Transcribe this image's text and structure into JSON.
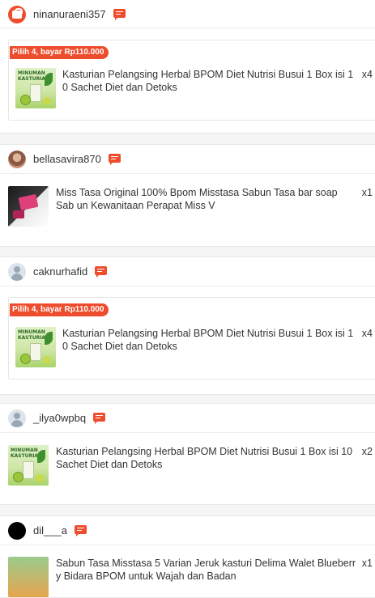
{
  "orders": [
    {
      "username": "ninanuraeni357",
      "promo": "Pilih 4, bayar Rp110.000",
      "item_title": "Kasturian Pelangsing Herbal BPOM Diet Nutrisi Busui 1 Box isi 1 0 Sachet Diet dan Detoks",
      "thumb_text": "MINUMAN KASTURIAN",
      "qty": "x4"
    },
    {
      "username": "bellasavira870",
      "item_title": "Miss Tasa Original 100% Bpom Misstasa Sabun Tasa bar soap Sab un Kewanitaan Perapat Miss V",
      "qty": "x1"
    },
    {
      "username": "caknurhafid",
      "promo": "Pilih 4, bayar Rp110.000",
      "item_title": "Kasturian Pelangsing Herbal BPOM Diet Nutrisi Busui 1 Box isi 1 0 Sachet Diet dan Detoks",
      "thumb_text": "MINUMAN KASTURIAN",
      "qty": "x4"
    },
    {
      "username": "_ilya0wpbq",
      "item_title": "Kasturian Pelangsing Herbal BPOM Diet Nutrisi Busui 1 Box isi 10 Sachet Diet dan Detoks",
      "thumb_text": "MINUMAN KASTURIAN",
      "qty": "x2"
    },
    {
      "username": "dil___a",
      "item_title": "Sabun Tasa Misstasa 5 Varian Jeruk kasturi Delima Walet Blueberr y Bidara BPOM untuk Wajah dan Badan",
      "qty": "x1"
    }
  ],
  "colors": {
    "accent": "#ee4d2d",
    "background": "#f5f5f5"
  },
  "icons": {
    "chat": "chat-icon",
    "shop_avatar": "shop-icon",
    "default_avatar": "user-icon"
  }
}
